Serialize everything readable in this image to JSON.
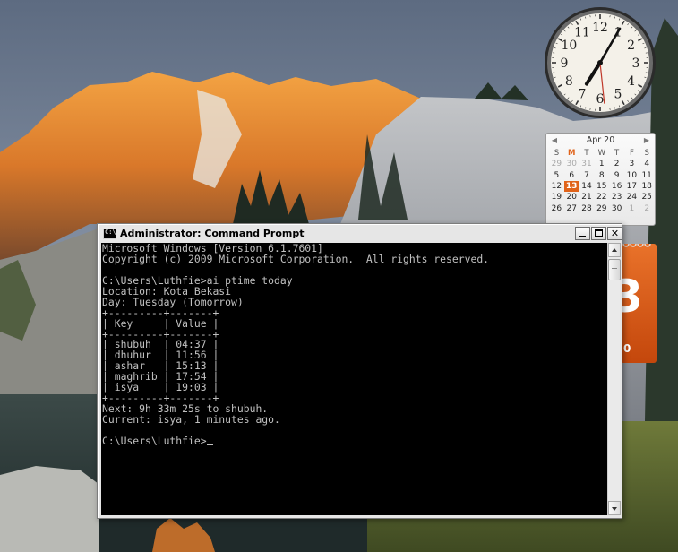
{
  "window": {
    "title": "Administrator: Command Prompt",
    "close_glyph": "✕"
  },
  "console": {
    "lines": [
      "Microsoft Windows [Version 6.1.7601]",
      "Copyright (c) 2009 Microsoft Corporation.  All rights reserved.",
      "",
      "C:\\Users\\Luthfie>ai ptime today",
      "Location: Kota Bekasi",
      "Day: Tuesday (Tomorrow)",
      "+---------+-------+",
      "| Key     | Value |",
      "+---------+-------+",
      "| shubuh  | 04:37 |",
      "| dhuhur  | 11:56 |",
      "| ashar   | 15:13 |",
      "| maghrib | 17:54 |",
      "| isya    | 19:03 |",
      "+---------+-------+",
      "Next: 9h 33m 25s to shubuh.",
      "Current: isya, 1 minutes ago.",
      "",
      "C:\\Users\\Luthfie>"
    ]
  },
  "calendar": {
    "month_label": "Apr 20",
    "prev_arrow": "◀",
    "next_arrow": "▶",
    "weekdays": [
      "S",
      "M",
      "T",
      "W",
      "T",
      "F",
      "S"
    ],
    "today_col": 1,
    "weeks": [
      [
        {
          "d": "29",
          "o": true
        },
        {
          "d": "30",
          "o": true
        },
        {
          "d": "31",
          "o": true
        },
        {
          "d": "1"
        },
        {
          "d": "2"
        },
        {
          "d": "3"
        },
        {
          "d": "4"
        }
      ],
      [
        {
          "d": "5"
        },
        {
          "d": "6"
        },
        {
          "d": "7"
        },
        {
          "d": "8"
        },
        {
          "d": "9"
        },
        {
          "d": "10"
        },
        {
          "d": "11"
        }
      ],
      [
        {
          "d": "12"
        },
        {
          "d": "13",
          "today": true
        },
        {
          "d": "14"
        },
        {
          "d": "15"
        },
        {
          "d": "16"
        },
        {
          "d": "17"
        },
        {
          "d": "18"
        }
      ],
      [
        {
          "d": "19"
        },
        {
          "d": "20"
        },
        {
          "d": "21"
        },
        {
          "d": "22"
        },
        {
          "d": "23"
        },
        {
          "d": "24"
        },
        {
          "d": "25"
        }
      ],
      [
        {
          "d": "26"
        },
        {
          "d": "27"
        },
        {
          "d": "28"
        },
        {
          "d": "29"
        },
        {
          "d": "30"
        },
        {
          "d": "1",
          "o": true
        },
        {
          "d": "2",
          "o": true
        }
      ]
    ]
  },
  "big_date_gadget": {
    "big_number": "3",
    "small_text": "0",
    "color": "#e0631a"
  },
  "clock_gadget": {
    "numerals": [
      "12",
      "1",
      "2",
      "3",
      "4",
      "5",
      "6",
      "7",
      "8",
      "9",
      "10",
      "11"
    ],
    "hour": 7,
    "minute": 5,
    "second": 29
  },
  "colors": {
    "console_bg": "#000000",
    "console_fg": "#c0c0c0",
    "accent": "#e0631a"
  }
}
